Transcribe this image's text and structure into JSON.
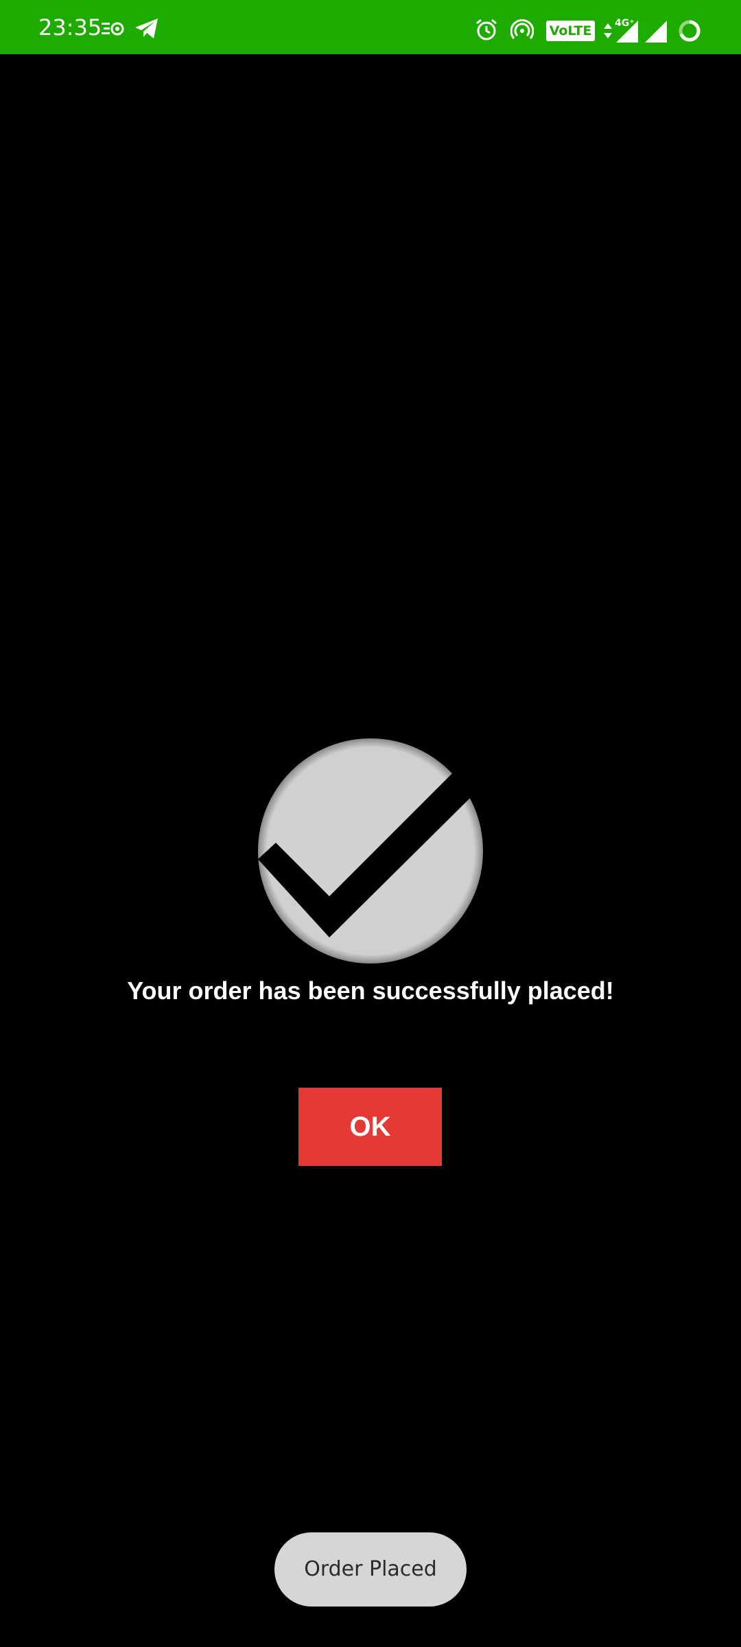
{
  "status_bar": {
    "time": "23:35",
    "background_color": "#1faa00",
    "volte_label": "VoLTE",
    "network_type": "4G⁺",
    "icons": [
      "data-saver-icon",
      "telegram-icon",
      "alarm-icon",
      "hotspot-icon",
      "volte-icon",
      "data-arrows-icon",
      "signal-icon",
      "signal-icon",
      "battery-ring-icon"
    ]
  },
  "dialog": {
    "icon": "check-circle-icon",
    "message": "Your order has been successfully placed!",
    "ok_label": "OK",
    "ok_color": "#e53935"
  },
  "toast": {
    "text": "Order Placed"
  }
}
